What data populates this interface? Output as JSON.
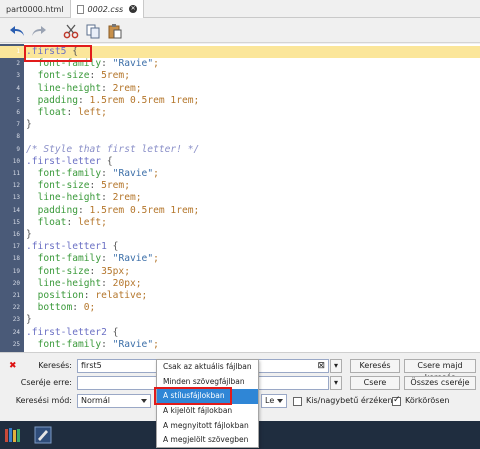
{
  "tabs": [
    {
      "label": "part0000.html",
      "active": false
    },
    {
      "label": "0002.css",
      "active": true
    }
  ],
  "toolbar": {
    "icons": [
      "undo-icon",
      "redo-icon",
      "cut-icon",
      "copy-icon",
      "paste-icon"
    ]
  },
  "editor": {
    "current_line": 1,
    "lines": [
      {
        "n": "1",
        "t": ".first5 {"
      },
      {
        "n": "2",
        "t": "  font-family: \"Ravie\";"
      },
      {
        "n": "3",
        "t": "  font-size: 5rem;"
      },
      {
        "n": "4",
        "t": "  line-height: 2rem;"
      },
      {
        "n": "5",
        "t": "  padding: 1.5rem 0.5rem 1rem;"
      },
      {
        "n": "6",
        "t": "  float: left;"
      },
      {
        "n": "7",
        "t": "}"
      },
      {
        "n": "8",
        "t": ""
      },
      {
        "n": "9",
        "t": "/* Style that first letter! */"
      },
      {
        "n": "10",
        "t": ".first-letter {"
      },
      {
        "n": "11",
        "t": "  font-family: \"Ravie\";"
      },
      {
        "n": "12",
        "t": "  font-size: 5rem;"
      },
      {
        "n": "13",
        "t": "  line-height: 2rem;"
      },
      {
        "n": "14",
        "t": "  padding: 1.5rem 0.5rem 1rem;"
      },
      {
        "n": "15",
        "t": "  float: left;"
      },
      {
        "n": "16",
        "t": "}"
      },
      {
        "n": "17",
        "t": ".first-letter1 {"
      },
      {
        "n": "18",
        "t": "  font-family: \"Ravie\";"
      },
      {
        "n": "19",
        "t": "  font-size: 35px;"
      },
      {
        "n": "20",
        "t": "  line-height: 20px;"
      },
      {
        "n": "21",
        "t": "  position: relative;"
      },
      {
        "n": "22",
        "t": "  bottom: 0;"
      },
      {
        "n": "23",
        "t": "}"
      },
      {
        "n": "24",
        "t": ".first-letter2 {"
      },
      {
        "n": "25",
        "t": "  font-family: \"Ravie\";"
      }
    ]
  },
  "find": {
    "search_label": "Keresés:",
    "search_value": "first5",
    "replace_label": "Cseréje erre:",
    "replace_value": "",
    "mode_label": "Keresési mód:",
    "mode_value": "Normál",
    "scope_value": "Csak az aktuális fájlban",
    "direction_value": "Le",
    "btn_find": "Keresés",
    "btn_replace_find": "Csere majd keresés",
    "btn_replace": "Csere",
    "btn_replace_all": "Összes cseréje",
    "case_label": "Kis/nagybetű érzékeny",
    "case_checked": false,
    "wrap_label": "Körkörösen",
    "wrap_checked": true
  },
  "scope_dropdown": {
    "selected_index": 2,
    "items": [
      "Csak az aktuális fájlban",
      "Minden szövegfájlban",
      "A stílusfájlokban",
      "A kijelölt fájlokban",
      "A megnyitott fájlokban",
      "A megjelölt szövegben"
    ]
  },
  "colors": {
    "gutter": "#4a5a78",
    "current_line": "#fbe69a",
    "highlight_box": "#e11b1b",
    "dropdown_selected": "#2f86d6",
    "taskbar": "#1f2d3f"
  }
}
